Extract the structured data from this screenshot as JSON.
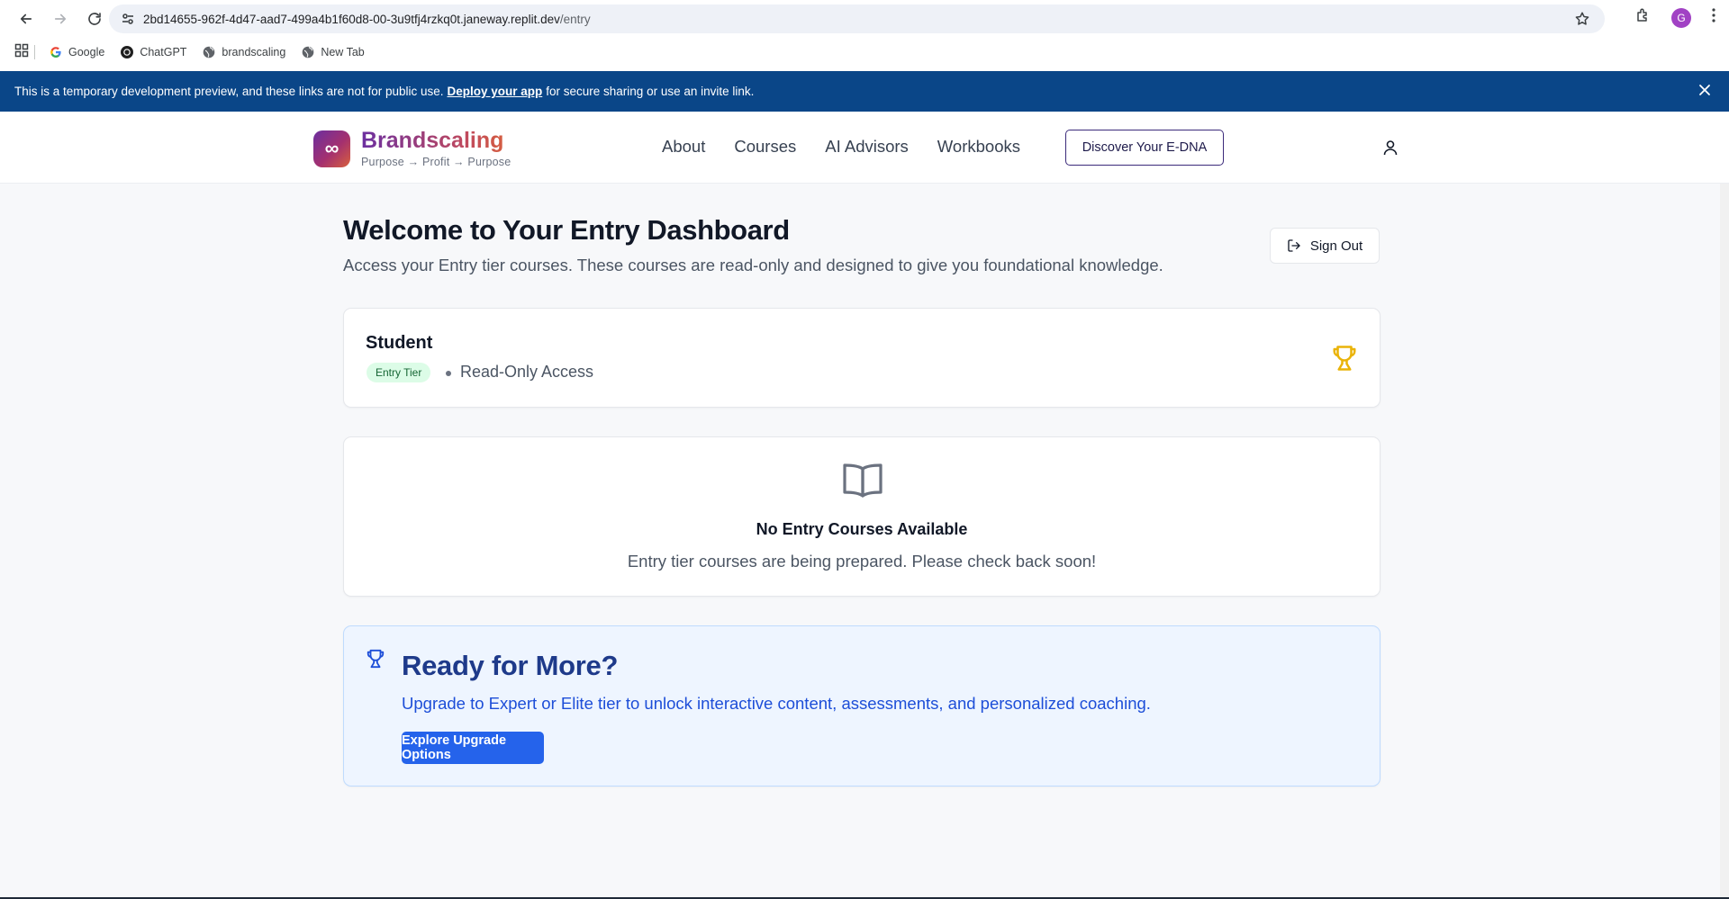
{
  "browser": {
    "url_host": "2bd14655-962f-4d47-aad7-499a4b1f60d8-00-3u9tfj4rzkq0t.janeway.replit.dev",
    "url_path": "/entry",
    "profile_initial": "G",
    "bookmarks": [
      {
        "label": "Google",
        "icon": "google-icon"
      },
      {
        "label": "ChatGPT",
        "icon": "chatgpt-icon"
      },
      {
        "label": "brandscaling",
        "icon": "globe-icon"
      },
      {
        "label": "New Tab",
        "icon": "globe-icon"
      }
    ]
  },
  "banner": {
    "text_before": "This is a temporary development preview, and these links are not for public use.",
    "link": "Deploy your app",
    "text_after": "for secure sharing or use an invite link."
  },
  "header": {
    "brand": "Brandscaling",
    "tagline": "Purpose → Profit → Purpose",
    "logo_glyph": "∞",
    "nav": [
      "About",
      "Courses",
      "AI Advisors",
      "Workbooks"
    ],
    "cta": "Discover Your E-DNA"
  },
  "page": {
    "title": "Welcome to Your Entry Dashboard",
    "subtitle": "Access your Entry tier courses. These courses are read-only and designed to give you foundational knowledge.",
    "sign_out": "Sign Out"
  },
  "student": {
    "name": "Student",
    "tier": "Entry Tier",
    "access": "Read-Only Access"
  },
  "empty_state": {
    "title": "No Entry Courses Available",
    "message": "Entry tier courses are being prepared. Please check back soon!"
  },
  "upgrade": {
    "title": "Ready for More?",
    "message": "Upgrade to Expert or Elite tier to unlock interactive content, assessments, and personalized coaching.",
    "button": "Explore Upgrade Options"
  },
  "colors": {
    "banner_bg": "#0a4688",
    "brand_purple": "#6b2fa0",
    "brand_orange": "#d8603c",
    "tier_badge_bg": "#dcfce7",
    "trophy_gold": "#eab308",
    "upgrade_bg": "#eef5ff",
    "primary_blue": "#2563eb"
  }
}
